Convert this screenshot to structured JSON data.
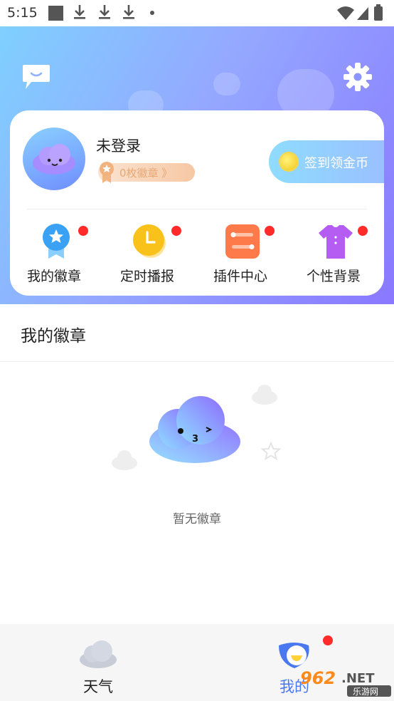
{
  "status_bar": {
    "time": "5:15"
  },
  "header": {
    "message_icon": "message-bubble-icon",
    "settings_icon": "gear-icon"
  },
  "profile": {
    "username": "未登录",
    "badge_count_label": "0枚徽章 》",
    "signin_label": "签到领金币"
  },
  "features": [
    {
      "label": "我的徽章",
      "icon": "badge-icon"
    },
    {
      "label": "定时播报",
      "icon": "clock-icon"
    },
    {
      "label": "插件中心",
      "icon": "plugin-icon"
    },
    {
      "label": "个性背景",
      "icon": "shirt-icon"
    }
  ],
  "section": {
    "title": "我的徽章",
    "empty_text": "暂无徽章"
  },
  "bottom_nav": {
    "items": [
      {
        "label": "天气",
        "icon": "cloud-icon"
      },
      {
        "label": "我的",
        "icon": "mine-icon",
        "active": true
      }
    ]
  },
  "colors": {
    "gradient_start": "#7fd0ff",
    "gradient_end": "#8a78ff",
    "active_tab": "#4a78f0",
    "notify_dot": "#ff2b2b"
  },
  "watermark": {
    "text": "962.NET",
    "sub": "乐游网"
  }
}
